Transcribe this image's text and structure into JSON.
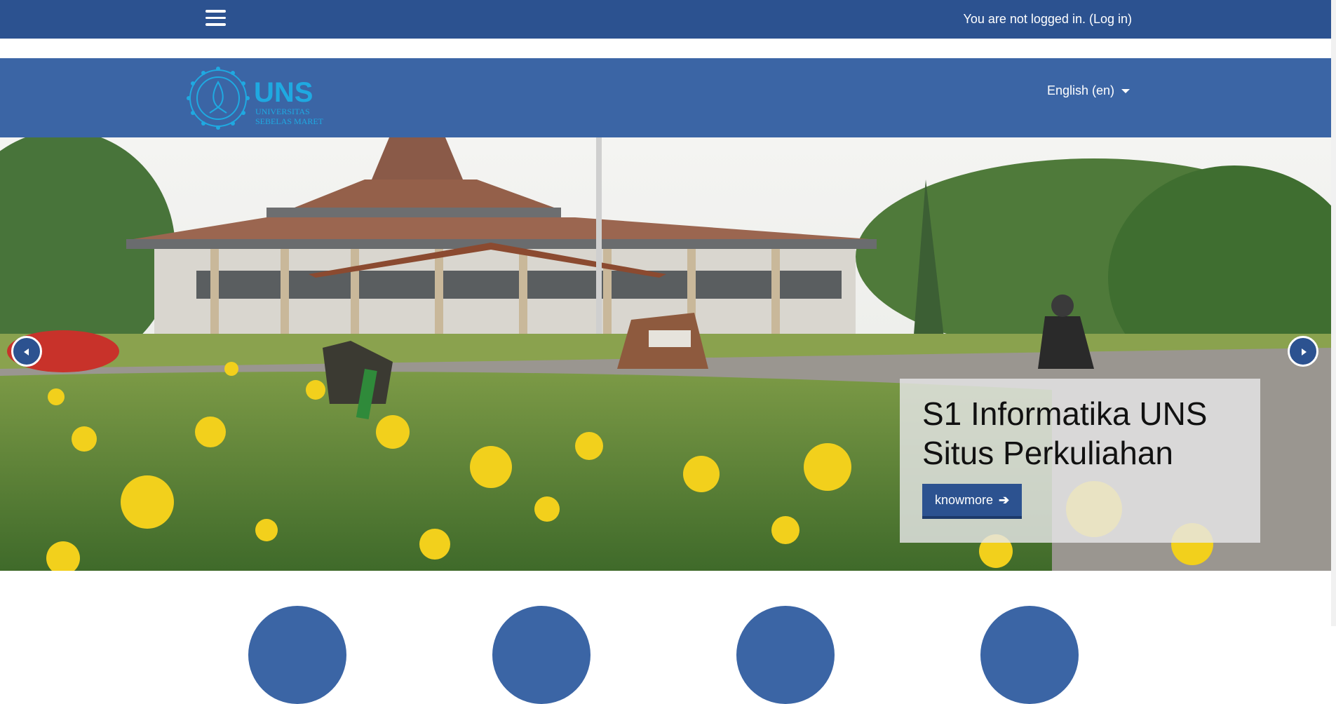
{
  "topbar": {
    "login_text": "You are not logged in.",
    "login_link": "(Log in)"
  },
  "brand": {
    "logo_title": "UNS",
    "logo_line1": "UNIVERSITAS",
    "logo_line2": "SEBELAS MARET"
  },
  "language": {
    "selected": "English (en)"
  },
  "slider": {
    "caption_line1": "S1 Informatika UNS",
    "caption_line2": "Situs Perkuliahan",
    "button_label": "knowmore"
  },
  "colors": {
    "topbar": "#2c5290",
    "brandbar": "#3b65a5",
    "logo": "#1fa9e1",
    "button": "#2c5290"
  },
  "icons": {
    "menu": "hamburger-icon",
    "prev": "chevron-left-icon",
    "next": "chevron-right-icon",
    "button": "arrow-right-icon"
  }
}
